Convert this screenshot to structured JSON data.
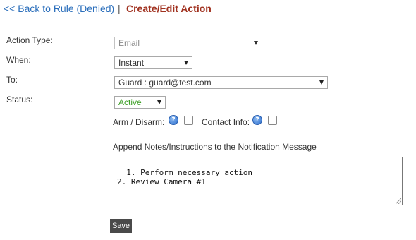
{
  "header": {
    "back_link": "<< Back to Rule (Denied)",
    "separator": "|",
    "title": "Create/Edit Action"
  },
  "form": {
    "action_type": {
      "label": "Action Type:",
      "value": "Email"
    },
    "when": {
      "label": "When:",
      "value": "Instant"
    },
    "to": {
      "label": "To:",
      "value": "Guard : guard@test.com"
    },
    "status": {
      "label": "Status:",
      "value": "Active"
    },
    "arm_disarm": {
      "label": "Arm / Disarm:",
      "help": "?"
    },
    "contact_info": {
      "label": "Contact Info:",
      "help": "?"
    },
    "notes": {
      "label": "Append Notes/Instructions to the Notification Message",
      "value": "1. Perform necessary action\n2. Review Camera #1"
    },
    "save_label": "Save"
  },
  "colors": {
    "link": "#2a6ebb",
    "title": "#a0311f",
    "status_active": "#3a9d23",
    "button_bg": "#4a4a4a"
  }
}
